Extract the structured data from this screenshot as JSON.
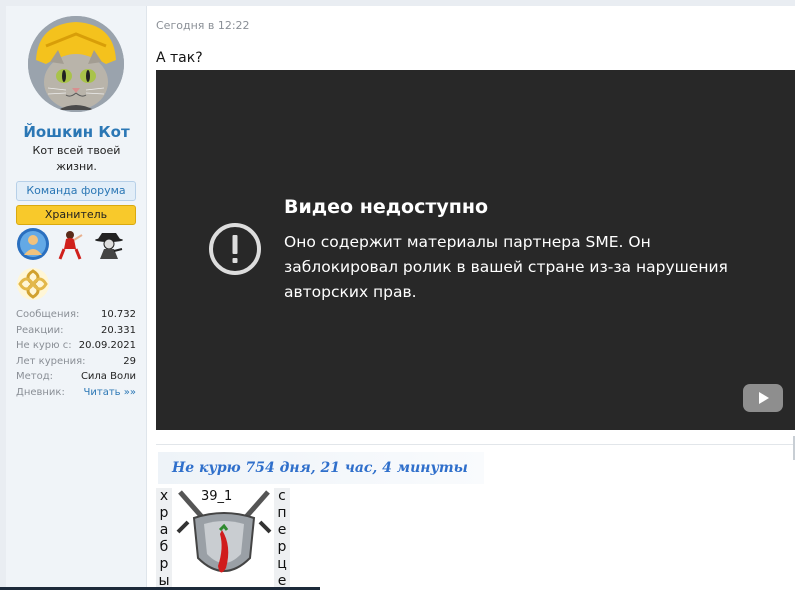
{
  "author": {
    "name": "Йошкин Кот",
    "title_line1": "Кот всей твоей",
    "title_line2": "жизни.",
    "banners": [
      "Команда форума",
      "Хранитель"
    ],
    "trophies": [
      "blue-person-icon",
      "red-dancer-icon",
      "spy-icon",
      "gold-knot-icon"
    ],
    "stats": [
      {
        "key": "Сообщения:",
        "value": "10.732"
      },
      {
        "key": "Реакции:",
        "value": "20.331"
      },
      {
        "key": "Не курю с:",
        "value": "20.09.2021"
      },
      {
        "key": "Лет курения:",
        "value": "29"
      },
      {
        "key": "Метод:",
        "value": "Сила Воли"
      },
      {
        "key": "Дневник:",
        "value": "Читать »»"
      }
    ]
  },
  "post": {
    "timestamp": "Сегодня в 12:22",
    "text": "А так?",
    "video": {
      "title": "Видео недоступно",
      "description": "Оно содержит материалы партнера SME. Он заблокировал ролик в вашей стране из-за нарушения авторских прав."
    }
  },
  "signature": {
    "counter": "Не курю  754 дня, 21 час, 4 минуты",
    "badge_label": "39_1",
    "left_column": [
      "х",
      "р",
      "а",
      "б",
      "р",
      "ы"
    ],
    "right_column": [
      "с",
      "п",
      "е",
      "р",
      "ц",
      "е"
    ]
  },
  "colors": {
    "accent": "#2b77b5",
    "keeper": "#f8c92b",
    "video_bg": "#282828",
    "signature_text": "#2f6fcb"
  }
}
